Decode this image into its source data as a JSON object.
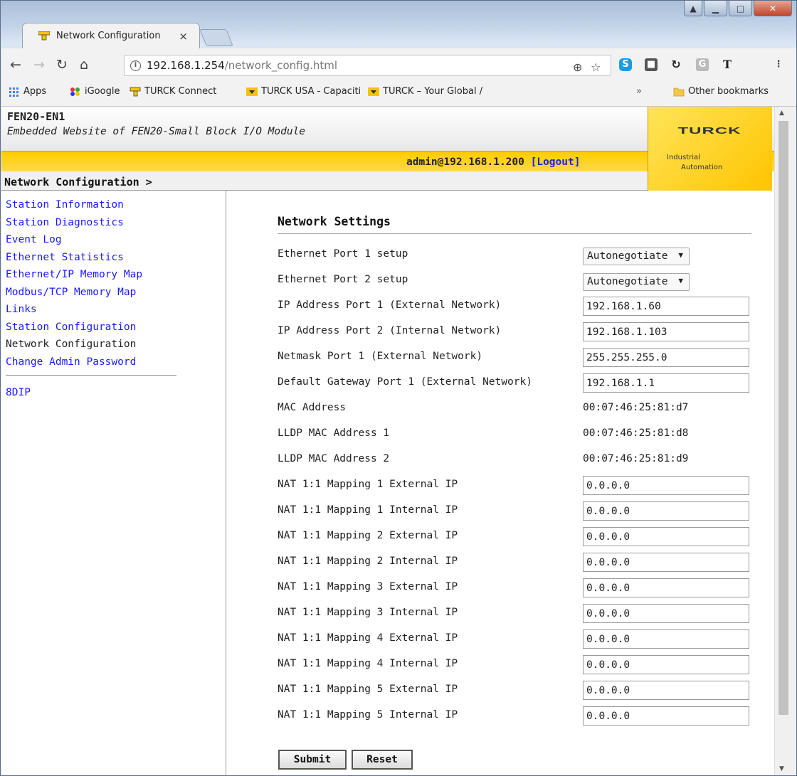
{
  "browser": {
    "tab_title": "Network Configuration",
    "tab_close": "×",
    "url_host": "192.168.1.254",
    "url_path": "/network_config.html",
    "info_glyph": "i",
    "bookmarks": [
      {
        "label": "Apps"
      },
      {
        "label": "iGoogle"
      },
      {
        "label": "TURCK Connect"
      },
      {
        "label": "TURCK USA - Capaciti"
      },
      {
        "label": "TURCK – Your Global /"
      }
    ],
    "overflow": "»",
    "other_bookmarks": "Other bookmarks"
  },
  "header": {
    "product": "FEN20-EN1",
    "subtitle": "Embedded Website of FEN20-Small Block I/O Module",
    "user": "admin@192.168.1.200",
    "logout": "[Logout]",
    "logo_word": "TURCK",
    "logo_line1": "Industrial",
    "logo_line2": "Automation"
  },
  "breadcrumb": "Network Configuration >",
  "sidebar": {
    "items": [
      {
        "label": "Station Information"
      },
      {
        "label": "Station Diagnostics"
      },
      {
        "label": "Event Log"
      },
      {
        "label": "Ethernet Statistics"
      },
      {
        "label": "Ethernet/IP Memory Map"
      },
      {
        "label": "Modbus/TCP Memory Map"
      },
      {
        "label": "Links"
      },
      {
        "label": "Station Configuration"
      },
      {
        "label": "Network Configuration"
      },
      {
        "label": "Change Admin Password"
      }
    ],
    "extra": "8DIP"
  },
  "form": {
    "title": "Network Settings",
    "rows": [
      {
        "label": "Ethernet Port 1 setup",
        "value": "Autonegotiate",
        "kind": "select"
      },
      {
        "label": "Ethernet Port 2 setup",
        "value": "Autonegotiate",
        "kind": "select"
      },
      {
        "label": "IP Address Port 1 (External Network)",
        "value": "192.168.1.60",
        "kind": "input"
      },
      {
        "label": "IP Address Port 2 (Internal Network)",
        "value": "192.168.1.103",
        "kind": "input"
      },
      {
        "label": "Netmask Port 1 (External Network)",
        "value": "255.255.255.0",
        "kind": "input"
      },
      {
        "label": "Default Gateway Port 1 (External Network)",
        "value": "192.168.1.1",
        "kind": "input"
      },
      {
        "label": "MAC Address",
        "value": "00:07:46:25:81:d7",
        "kind": "text"
      },
      {
        "label": "LLDP MAC Address 1",
        "value": "00:07:46:25:81:d8",
        "kind": "text"
      },
      {
        "label": "LLDP MAC Address 2",
        "value": "00:07:46:25:81:d9",
        "kind": "text"
      },
      {
        "label": "NAT 1:1 Mapping 1 External IP",
        "value": "0.0.0.0",
        "kind": "input"
      },
      {
        "label": "NAT 1:1 Mapping 1 Internal IP",
        "value": "0.0.0.0",
        "kind": "input"
      },
      {
        "label": "NAT 1:1 Mapping 2 External IP",
        "value": "0.0.0.0",
        "kind": "input"
      },
      {
        "label": "NAT 1:1 Mapping 2 Internal IP",
        "value": "0.0.0.0",
        "kind": "input"
      },
      {
        "label": "NAT 1:1 Mapping 3 External IP",
        "value": "0.0.0.0",
        "kind": "input"
      },
      {
        "label": "NAT 1:1 Mapping 3 Internal IP",
        "value": "0.0.0.0",
        "kind": "input"
      },
      {
        "label": "NAT 1:1 Mapping 4 External IP",
        "value": "0.0.0.0",
        "kind": "input"
      },
      {
        "label": "NAT 1:1 Mapping 4 Internal IP",
        "value": "0.0.0.0",
        "kind": "input"
      },
      {
        "label": "NAT 1:1 Mapping 5 External IP",
        "value": "0.0.0.0",
        "kind": "input"
      },
      {
        "label": "NAT 1:1 Mapping 5 Internal IP",
        "value": "0.0.0.0",
        "kind": "input"
      }
    ],
    "submit": "Submit",
    "reset": "Reset",
    "select_arrow": "▼"
  },
  "colors": {
    "link": "#1a1aff",
    "brand_yellow": "#ffcc00"
  }
}
